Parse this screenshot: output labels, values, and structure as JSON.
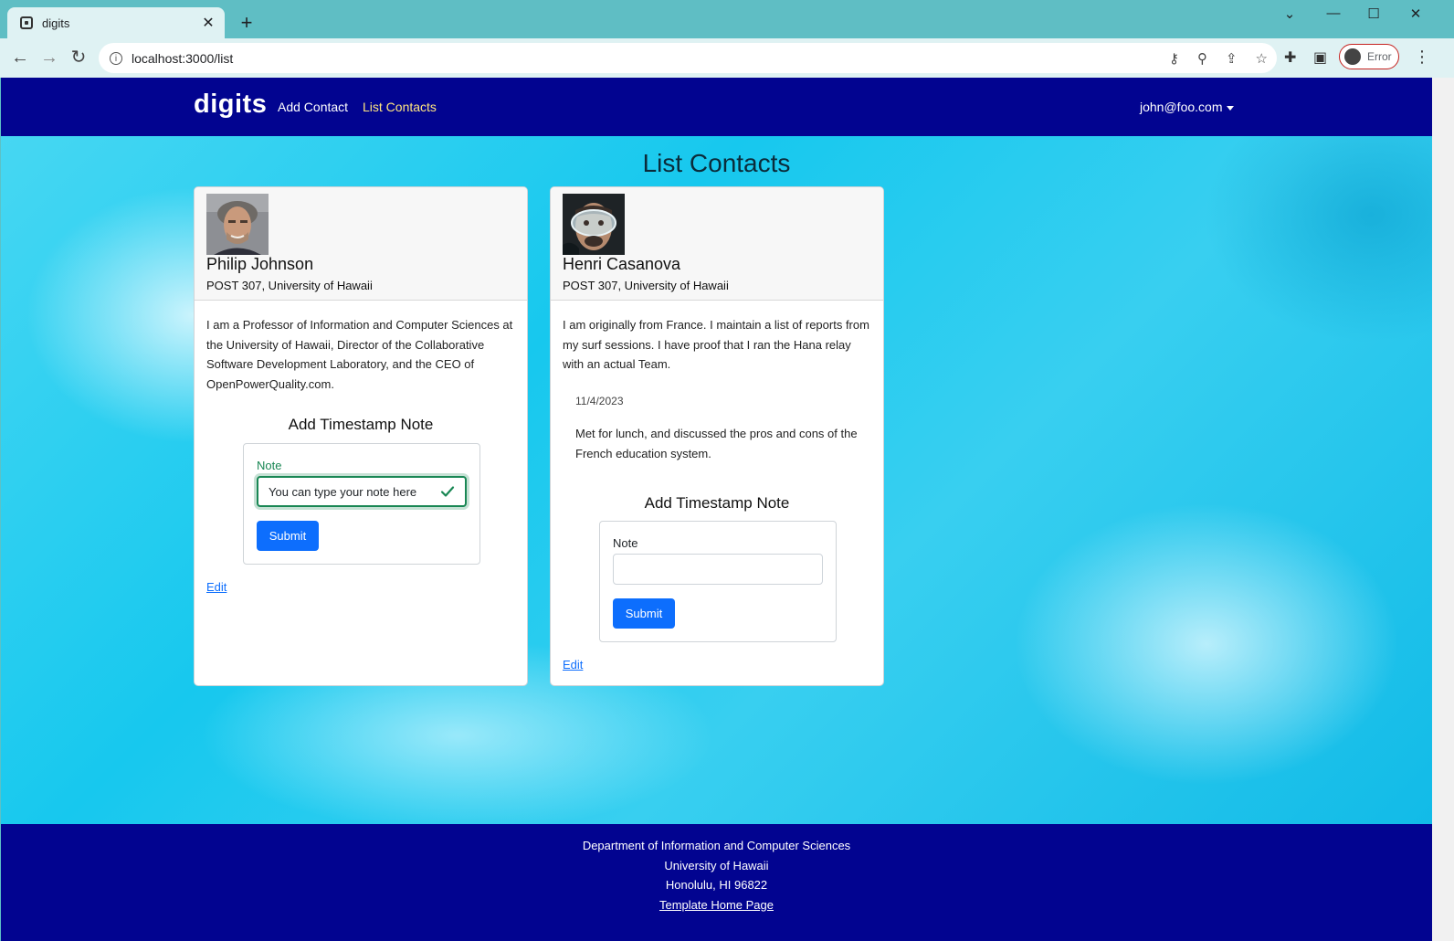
{
  "browser": {
    "tab_title": "digits",
    "new_tab": "+",
    "close_tab": "✕",
    "url": "localhost:3000/list",
    "profile_label": "Error"
  },
  "navbar": {
    "brand": "digits",
    "links": [
      {
        "label": "Add Contact",
        "active": false
      },
      {
        "label": "List Contacts",
        "active": true
      }
    ],
    "user": "john@foo.com"
  },
  "page_title": "List Contacts",
  "contacts": [
    {
      "name": "Philip Johnson",
      "address": "POST 307, University of Hawaii",
      "description": "I am a Professor of Information and Computer Sciences at the University of Hawaii, Director of the Collaborative Software Development Laboratory, and the CEO of OpenPowerQuality.com.",
      "notes": [],
      "form": {
        "title": "Add Timestamp Note",
        "label": "Note",
        "value": "You can type your note here",
        "submit": "Submit"
      },
      "edit": "Edit"
    },
    {
      "name": "Henri Casanova",
      "address": "POST 307, University of Hawaii",
      "description": "I am originally from France. I maintain a list of reports from my surf sessions. I have proof that I ran the Hana relay with an actual Team.",
      "notes": [
        {
          "date": "11/4/2023",
          "text": "Met for lunch, and discussed the pros and cons of the French education system."
        }
      ],
      "form": {
        "title": "Add Timestamp Note",
        "label": "Note",
        "value": "",
        "submit": "Submit"
      },
      "edit": "Edit"
    }
  ],
  "footer": {
    "lines": [
      "Department of Information and Computer Sciences",
      "University of Hawaii",
      "Honolulu, HI 96822"
    ],
    "link": "Template Home Page"
  },
  "colors": {
    "navbar": "#020490",
    "primary": "#0d6efd",
    "valid": "#198754"
  }
}
